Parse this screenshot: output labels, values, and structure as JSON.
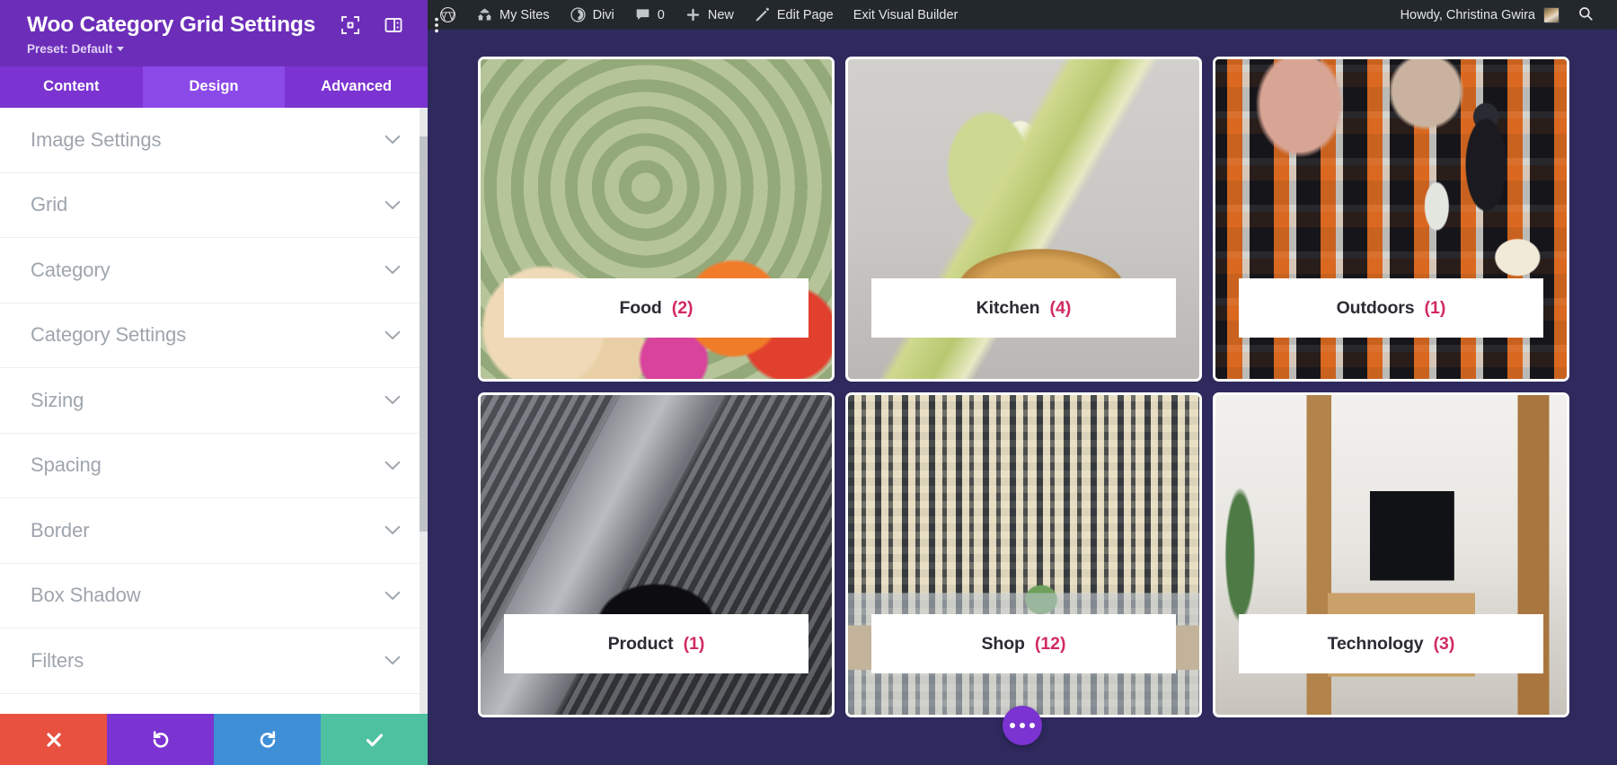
{
  "settings_panel": {
    "title": "Woo Category Grid Settings",
    "preset_label": "Preset: Default",
    "header_icons": [
      {
        "name": "focus-target-icon"
      },
      {
        "name": "layout-panel-icon"
      },
      {
        "name": "more-vertical-icon"
      }
    ],
    "tabs": [
      {
        "label": "Content",
        "active": false
      },
      {
        "label": "Design",
        "active": true
      },
      {
        "label": "Advanced",
        "active": false
      }
    ],
    "sections": [
      {
        "label": "Image Settings"
      },
      {
        "label": "Grid"
      },
      {
        "label": "Category"
      },
      {
        "label": "Category Settings"
      },
      {
        "label": "Sizing"
      },
      {
        "label": "Spacing"
      },
      {
        "label": "Border"
      },
      {
        "label": "Box Shadow"
      },
      {
        "label": "Filters"
      }
    ],
    "footer_buttons": [
      {
        "name": "cancel-button",
        "icon": "close-icon",
        "color": "#e8503f"
      },
      {
        "name": "undo-button",
        "icon": "undo-icon",
        "color": "#7b33d1"
      },
      {
        "name": "redo-button",
        "icon": "redo-icon",
        "color": "#3e8fd6"
      },
      {
        "name": "save-button",
        "icon": "check-icon",
        "color": "#4ec2a0"
      }
    ],
    "accent_color": "#6c2eb9",
    "tab_active_color": "#8b49e8"
  },
  "admin_bar": {
    "items": [
      {
        "label": "",
        "icon": "wordpress-logo-icon"
      },
      {
        "label": "My Sites",
        "icon": "sites-icon"
      },
      {
        "label": "Divi",
        "icon": "divi-icon"
      },
      {
        "label": "0",
        "icon": "comment-icon"
      },
      {
        "label": "New",
        "icon": "plus-icon"
      },
      {
        "label": "Edit Page",
        "icon": "pencil-icon"
      },
      {
        "label": "Exit Visual Builder",
        "icon": ""
      }
    ],
    "howdy": "Howdy, Christina Gwira",
    "search_icon": "search-icon",
    "background": "#23282d"
  },
  "canvas": {
    "background": "#2e2a5e",
    "fab": {
      "name": "options-fab",
      "icon": "ellipsis-icon",
      "color": "#7b33d1"
    },
    "cards": [
      {
        "name": "Food",
        "count": "(2)",
        "image": "artichoke-and-fruit-photo",
        "img_class": "img-food"
      },
      {
        "name": "Kitchen",
        "count": "(4)",
        "image": "bagel-and-lettuce-photo",
        "img_class": "img-kitchen"
      },
      {
        "name": "Outdoors",
        "count": "(1)",
        "image": "picnic-blanket-photo",
        "img_class": "img-outdoors"
      },
      {
        "name": "Product",
        "count": "(1)",
        "image": "laptop-and-headphones-photo",
        "img_class": "img-product"
      },
      {
        "name": "Shop",
        "count": "(12)",
        "image": "dining-table-interior-photo",
        "img_class": "img-shop"
      },
      {
        "name": "Technology",
        "count": "(3)",
        "image": "living-room-tv-photo",
        "img_class": "img-tech"
      }
    ],
    "count_color": "#d12a64",
    "name_color": "#2b2b33"
  }
}
